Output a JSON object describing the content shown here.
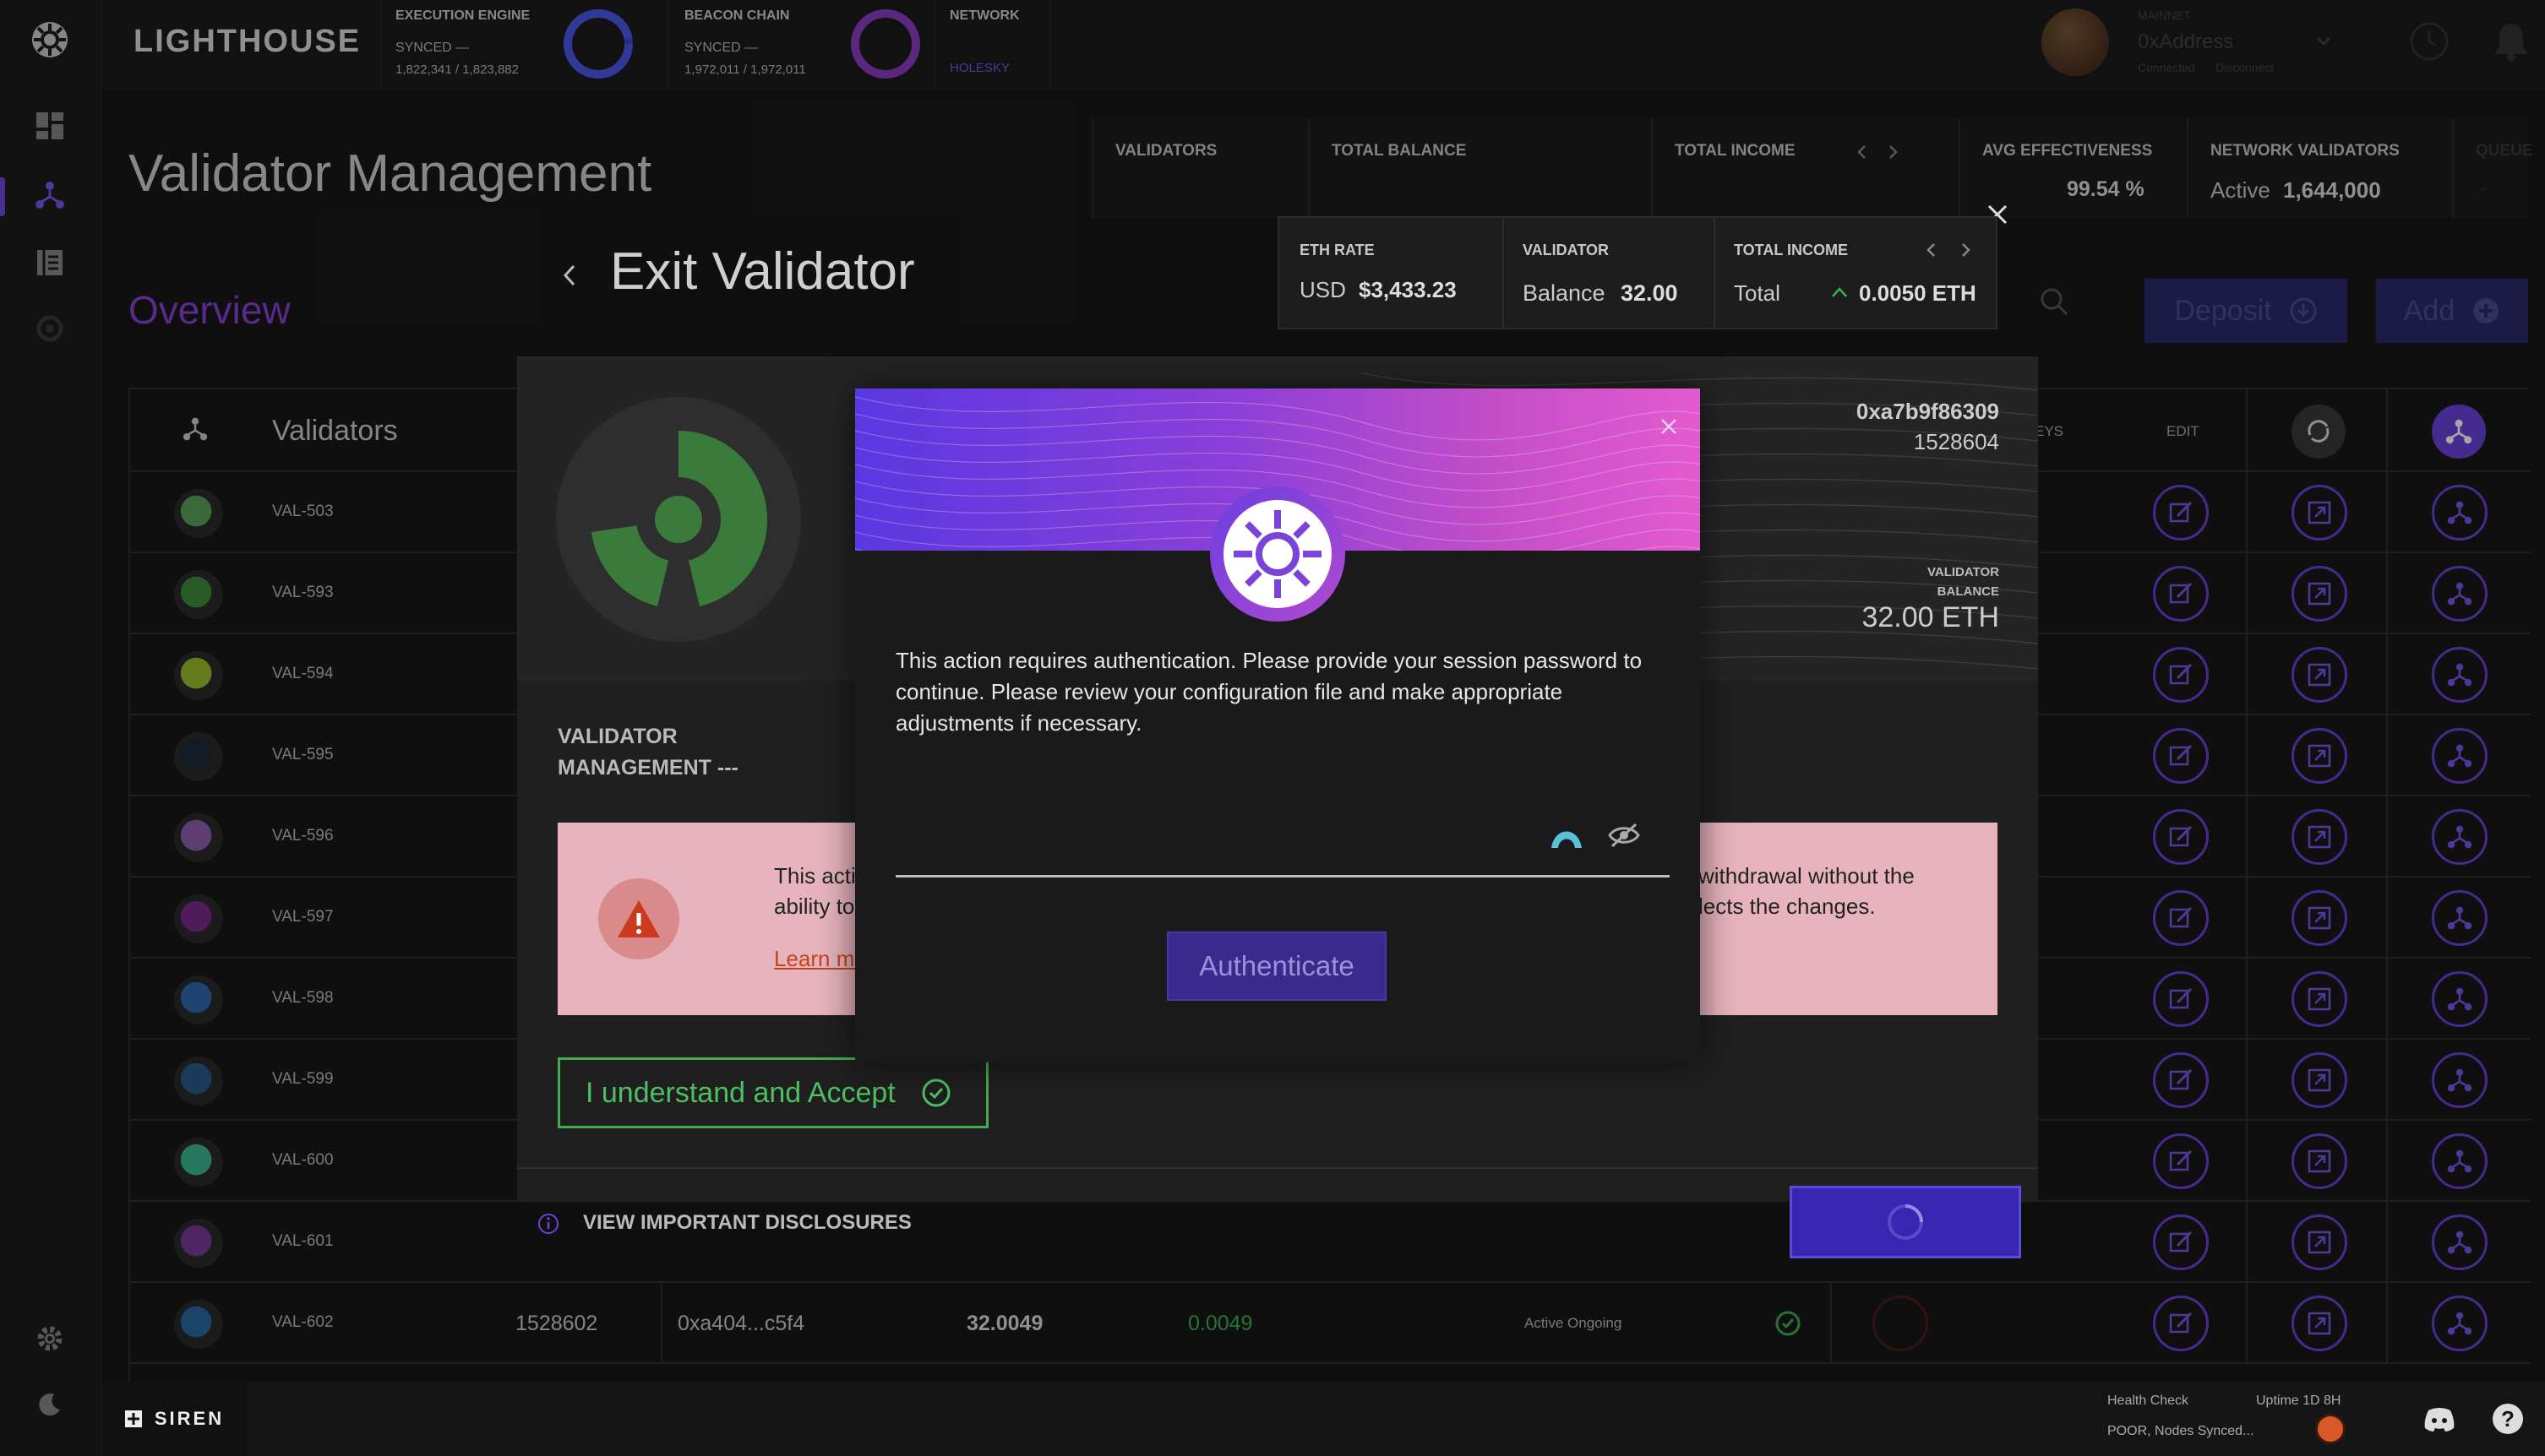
{
  "brand": {
    "name": "LIGHTHOUSE",
    "footer_brand": "SIREN"
  },
  "topbar": {
    "execution": {
      "label": "EXECUTION ENGINE",
      "status": "SYNCED —",
      "progress": "1,822,341 / 1,823,882",
      "sync_fraction": 0.999
    },
    "beacon": {
      "label": "BEACON CHAIN",
      "status": "SYNCED —",
      "progress": "1,972,011 / 1,972,011",
      "sync_fraction": 1.0
    },
    "network": {
      "label": "NETWORK",
      "value": "HOLESKY"
    },
    "account": {
      "network": "MAINNET",
      "address": "0xAddress",
      "connected": "Connected",
      "disconnect": "Disconnect"
    }
  },
  "page": {
    "title": "Validator Management",
    "overview": "Overview"
  },
  "stats": {
    "validators": "VALIDATORS",
    "total_balance": "TOTAL BALANCE",
    "total_income": "TOTAL INCOME",
    "avg_effectiveness": {
      "label": "AVG EFFECTIVENESS",
      "value": "99.54 %"
    },
    "network_validators": {
      "label": "NETWORK VALIDATORS",
      "status": "Active",
      "value": "1,644,000"
    },
    "queue": {
      "label": "QUEUE",
      "value": "-"
    }
  },
  "actions": {
    "deposit": "Deposit",
    "add": "Add"
  },
  "table": {
    "header": {
      "validators": "Validators",
      "keys": "EYS",
      "edit": "EDIT"
    },
    "rows": [
      {
        "name": "VAL-503",
        "avatar": "#5aa05a"
      },
      {
        "name": "VAL-593",
        "avatar": "#3e8a3e"
      },
      {
        "name": "VAL-594",
        "avatar": "#9bbf2e"
      },
      {
        "name": "VAL-595",
        "avatar": "#1c2a3a"
      },
      {
        "name": "VAL-596",
        "avatar": "#9060b0"
      },
      {
        "name": "VAL-597",
        "avatar": "#7a2a8a"
      },
      {
        "name": "VAL-598",
        "avatar": "#2e6ab0"
      },
      {
        "name": "VAL-599",
        "avatar": "#2a5a8a"
      },
      {
        "name": "VAL-600",
        "avatar": "#3ab890"
      },
      {
        "name": "VAL-601",
        "avatar": "#7a3a9a"
      },
      {
        "name": "VAL-602",
        "avatar": "#2a6aa0",
        "index": "1528602",
        "pubkey": "0xa404...c5f4",
        "balance": "32.0049",
        "income": "0.0049",
        "status": "Active Ongoing"
      }
    ]
  },
  "exit_panel": {
    "title": "Exit Validator",
    "pubkey": "0xa7b9f86309",
    "index": "1528604",
    "balance_label": "VALIDATOR BALANCE",
    "balance": "32.00 ETH",
    "section": "VALIDATOR MANAGEMENT ---",
    "warning_left_1": "This acti",
    "warning_left_2": "ability to",
    "learn_more": "Learn mo",
    "warning_right_1": "withdrawal without the",
    "warning_right_2": "lects the changes.",
    "accept": "I understand and Accept",
    "disclosures": "VIEW IMPORTANT DISCLOSURES"
  },
  "eth_panel": {
    "rate_label": "ETH RATE",
    "currency": "USD",
    "rate": "$3,433.23",
    "validator_label": "VALIDATOR",
    "balance_label": "Balance",
    "balance": "32.00",
    "income_label": "TOTAL INCOME",
    "total_label": "Total",
    "income": "0.0050 ETH"
  },
  "modal": {
    "message": "This action requires authentication. Please provide your session password to continue. Please review your configuration file and make appropriate adjustments if necessary.",
    "password_placeholder": "",
    "button": "Authenticate"
  },
  "footer": {
    "health_label": "Health Check",
    "uptime": "Uptime 1D 8H",
    "health_status": "POOR, Nodes Synced..."
  },
  "colors": {
    "accent": "#6a42dd",
    "purple": "#8b3fd6",
    "green": "#3fae52",
    "warning": "#d9604a"
  }
}
